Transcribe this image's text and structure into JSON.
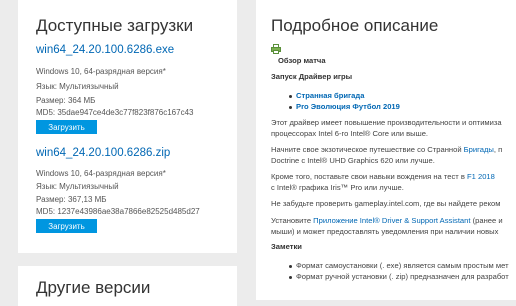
{
  "left": {
    "title": "Доступные загрузки",
    "downloads": [
      {
        "filename": "win64_24.20.100.6286.exe",
        "os": "Windows 10, 64-разрядная версия*",
        "language": "Язык: Мультиязычный",
        "size": "Размер: 364 МБ",
        "md5": "MD5: 35dae947ce4de3c77f823f876c167c43",
        "button": "Загрузить"
      },
      {
        "filename": "win64_24.20.100.6286.zip",
        "os": "Windows 10, 64-разрядная версия*",
        "language": "Язык: Мультиязычный",
        "size": "Размер: 367,13 МБ",
        "md5": "MD5: 1237e43986ae38a7866e82525d485d27",
        "button": "Загрузить"
      }
    ],
    "other_title": "Другие версии"
  },
  "right": {
    "title": "Подробное описание",
    "overview": "Обзор матча",
    "launch_heading": "Запуск Драйвер игры",
    "games": [
      "Странная бригада",
      "Pro Эволюция Футбол 2019"
    ],
    "p1_line1": "Этот драйвер имеет повышение производительности и оптимиза",
    "p1_line2": "процессорах Intel 6-го Intel® Core или выше.",
    "p2_line1_pre": "Начните свое экзотическое путешествие со Странной ",
    "p2_line1_link": "Бригады",
    "p2_line1_post": ", п",
    "p2_line2": "Doctrine с Intel® UHD Graphics 620 или лучше.",
    "p3_line1_pre": "Кроме того, поставьте свои навыки вождения на тест в ",
    "p3_line1_link": "F1 2018 ",
    "p3_line2": "с Intel® графика Iris™ Pro или лучше.",
    "p4": "Не забудьте проверить gameplay.intel.com, где вы найдете реком",
    "p5_line1_pre": "Установите ",
    "p5_line1_link": "Приложение Intel® Driver & Support Assistant",
    "p5_line1_post": " (ранее и",
    "p5_line2": "мыши) и может предоставлять уведомления при наличии новых",
    "notes_heading": "Заметки",
    "notes": [
      "Формат самоустановки (. exe) является самым простым мет",
      "Формат ручной установки (. zip) предназначен для разработ"
    ]
  }
}
